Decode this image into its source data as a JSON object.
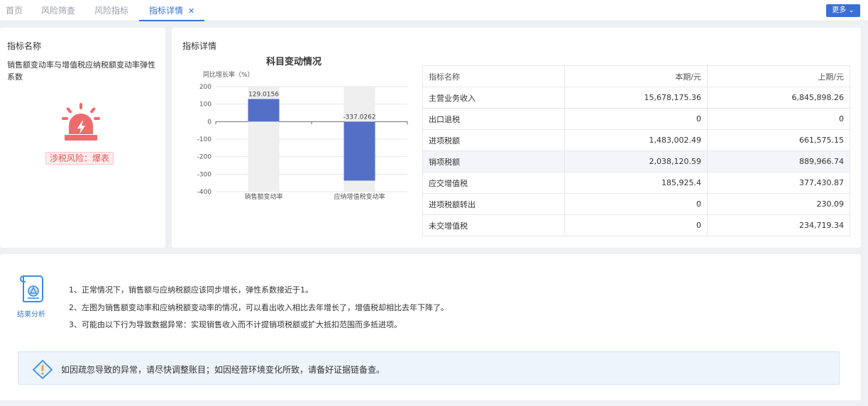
{
  "tabs": [
    {
      "label": "首页"
    },
    {
      "label": "风险筛查"
    },
    {
      "label": "风险指标"
    },
    {
      "label": "指标详情"
    }
  ],
  "more_button": {
    "label": "更多"
  },
  "indicator": {
    "title": "指标名称",
    "name": "销售额变动率与增值税应纳税额变动率弹性系数",
    "risk_label": "涉税风险：爆表",
    "risk_color": "#e8575a"
  },
  "detail": {
    "title": "指标详情"
  },
  "chart_data": {
    "type": "bar",
    "title": "科目变动情况",
    "ylabel": "同比增长率（%）",
    "categories": [
      "销售额变动率",
      "应纳增值税变动率"
    ],
    "values": [
      129.0156,
      -337.0262
    ],
    "value_labels": [
      "129.0156",
      "-337.0262"
    ],
    "ylim": [
      -400,
      200
    ],
    "yticks": [
      "200",
      "100",
      "0",
      "-100",
      "-200",
      "-300",
      "-400"
    ],
    "bar_color": "#5470c6",
    "grid": true
  },
  "table": {
    "headers": [
      "指标名称",
      "本期/元",
      "上期/元"
    ],
    "rows": [
      [
        "主营业务收入",
        "15,678,175.36",
        "6,845,898.26"
      ],
      [
        "出口退税",
        "0",
        "0"
      ],
      [
        "进项税额",
        "1,483,002.49",
        "661,575.15"
      ],
      [
        "销项税额",
        "2,038,120.59",
        "889,966.74"
      ],
      [
        "应交增值税",
        "185,925.4",
        "377,430.87"
      ],
      [
        "进项税额转出",
        "0",
        "230.09"
      ],
      [
        "未交增值税",
        "0",
        "234,719.34"
      ]
    ]
  },
  "analysis": {
    "label": "结果分析",
    "lines": [
      "1、正常情况下，销售额与应纳税额应该同步增长，弹性系数接近于1。",
      "2、左图为销售额变动率和应纳税额变动率的情况，可以看出收入相比去年增长了，增值税却相比去年下降了。",
      "3、可能由以下行为导致数据异常：实现销售收入而不计提销项税额或扩大抵扣范围而多抵进项。"
    ],
    "tip": "如因疏忽导致的异常，请尽快调整账目；如因经营环境变化所致，请备好证据链备查。"
  },
  "colors": {
    "accent": "#3a6fd8",
    "danger": "#e8575a"
  }
}
